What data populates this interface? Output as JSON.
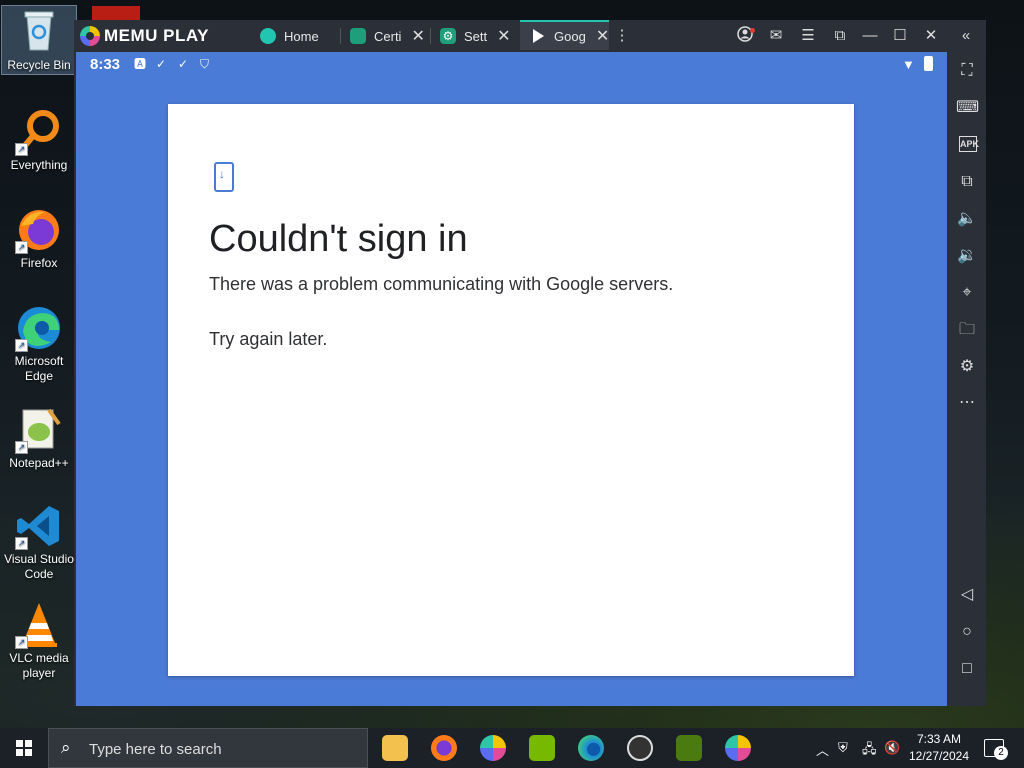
{
  "desktop": {
    "icons": [
      {
        "label": "Recycle Bin"
      },
      {
        "label": "Everything"
      },
      {
        "label": "Firefox"
      },
      {
        "label": "Microsoft Edge"
      },
      {
        "label": "Notepad++"
      },
      {
        "label": "Visual Studio Code"
      },
      {
        "label": "VLC media player"
      }
    ]
  },
  "emulator": {
    "brand": "MEMU PLAY",
    "tabs": [
      {
        "label": "Home",
        "icon": "home-app-icon",
        "color": "#22c6b0"
      },
      {
        "label": "Certi",
        "icon": "certi-app-icon",
        "color": "#1e9e7a"
      },
      {
        "label": "Sett",
        "icon": "settings-app-icon",
        "color": "#1e9e7a"
      },
      {
        "label": "Goog",
        "icon": "google-play-icon",
        "color": "#ffffff"
      }
    ],
    "active_tab": "Goog",
    "accent": "#22c6b0"
  },
  "android": {
    "time": "8:33",
    "background": "#4a7bd6",
    "dialog": {
      "title": "Couldn't sign in",
      "message": "There was a problem communicating with Google servers.",
      "message2": "Try again later."
    }
  },
  "sidebar_tools": [
    "fullscreen-icon",
    "keyboard-icon",
    "apk-icon",
    "multi-instance-icon",
    "volume-up-icon",
    "volume-down-icon",
    "location-icon",
    "folder-icon",
    "settings-gear-icon",
    "more-icon",
    "back-icon",
    "home-circle-icon",
    "recents-square-icon"
  ],
  "sidebar_apk_label": "APK",
  "taskbar": {
    "search_placeholder": "Type here to search",
    "time": "7:33 AM",
    "date": "12/27/2024",
    "notifications": "2"
  }
}
